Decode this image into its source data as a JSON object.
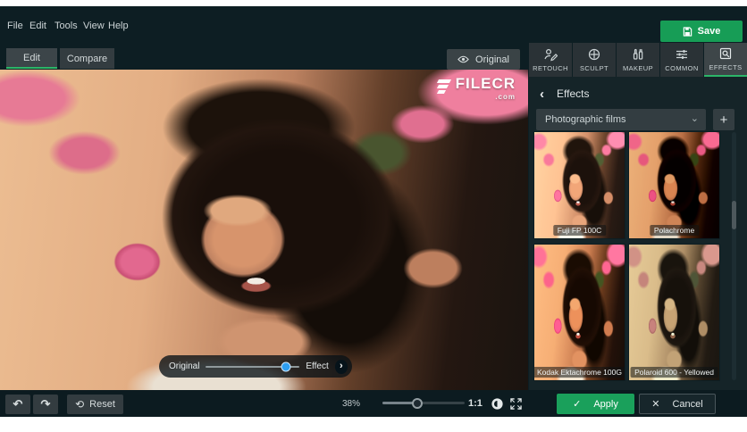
{
  "window": {
    "menu": {
      "items": [
        "File",
        "Edit",
        "Tools",
        "View",
        "Help"
      ]
    },
    "save": {
      "label": "Save"
    }
  },
  "view_tabs": {
    "edit": "Edit",
    "compare": "Compare"
  },
  "canvas": {
    "original_button": {
      "label": "Original"
    },
    "watermark": {
      "name": "FILECR",
      "tld": ".com"
    },
    "blend": {
      "original_label": "Original",
      "effect_label": "Effect",
      "arrow": "›"
    }
  },
  "panel": {
    "tabs": [
      {
        "label": "RETOUCH"
      },
      {
        "label": "SCULPT"
      },
      {
        "label": "MAKEUP"
      },
      {
        "label": "COMMON"
      },
      {
        "label": "EFFECTS"
      }
    ],
    "active_tab": "EFFECTS",
    "back_icon": "‹",
    "title": "Effects",
    "dropdown": {
      "value": "Photographic films",
      "caret": "⌄"
    },
    "add_button": "+",
    "effects": [
      {
        "name": "Fuji FP 100C"
      },
      {
        "name": "Polachrome"
      },
      {
        "name": "Kodak Ektachrome 100G"
      },
      {
        "name": "Polaroid 600 - Yellowed"
      }
    ]
  },
  "toolbar": {
    "undo_icon": "↶",
    "redo_icon": "↷",
    "reset_icon": "⟲",
    "reset_label": "Reset",
    "zoom_percent": "38%",
    "actual_size": "1:1",
    "apply": {
      "icon": "✓",
      "label": "Apply"
    },
    "cancel": {
      "icon": "✕",
      "label": "Cancel"
    }
  },
  "colors": {
    "accent_green": "#1aa05b",
    "tab_underline_green": "#2cb568",
    "slider_knob_blue": "#2f9ff2"
  }
}
